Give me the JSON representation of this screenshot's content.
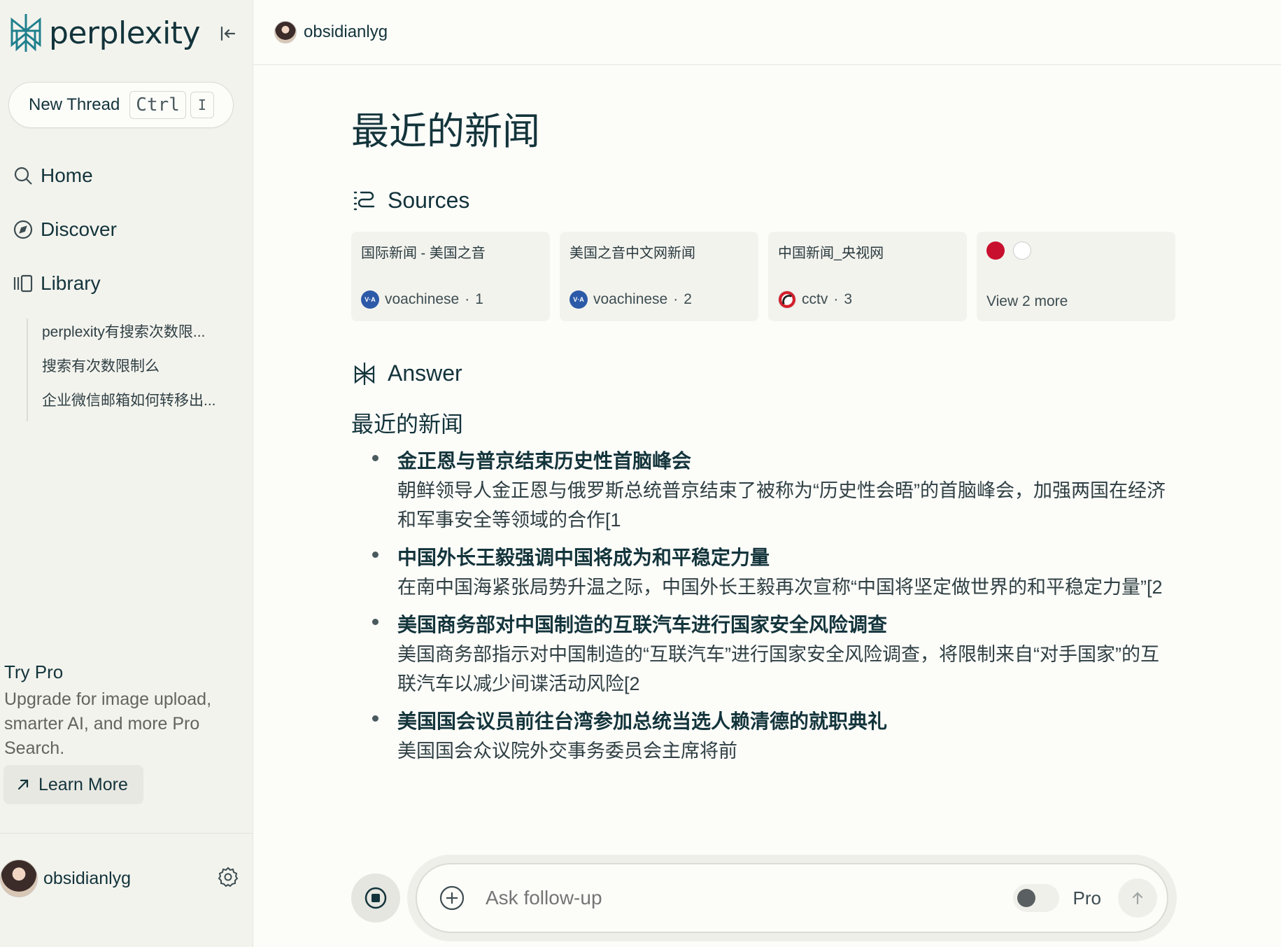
{
  "sidebar": {
    "brand": "perplexity",
    "new_thread": {
      "label": "New Thread",
      "kbd1": "Ctrl",
      "kbd2": "I"
    },
    "nav": [
      {
        "label": "Home",
        "icon": "search-icon"
      },
      {
        "label": "Discover",
        "icon": "compass-icon"
      },
      {
        "label": "Library",
        "icon": "library-icon"
      }
    ],
    "library_items": [
      "perplexity有搜索次数限...",
      "搜索有次数限制么",
      "企业微信邮箱如何转移出..."
    ],
    "try_pro": {
      "title": "Try Pro",
      "description": "Upgrade for image upload, smarter AI, and more Pro Search.",
      "learn_more": "Learn More"
    },
    "user": {
      "name": "obsidianlyg"
    }
  },
  "header": {
    "user_name": "obsidianlyg"
  },
  "main": {
    "title": "最近的新闻",
    "sources_heading": "Sources",
    "sources": [
      {
        "title": "国际新闻 - 美国之音",
        "site": "voachinese",
        "index": "1",
        "favicon": "V·A"
      },
      {
        "title": "美国之音中文网新闻",
        "site": "voachinese",
        "index": "2",
        "favicon": "V·A"
      },
      {
        "title": "中国新闻_央视网",
        "site": "cctv",
        "index": "3",
        "favicon": ""
      }
    ],
    "view_more": "View 2 more",
    "answer_heading": "Answer",
    "answer_subtitle": "最近的新闻",
    "answer_items": [
      {
        "title": "金正恩与普京结束历史性首脑峰会",
        "desc": "朝鲜领导人金正恩与俄罗斯总统普京结束了被称为“历史性会晤”的首脑峰会，加强两国在经济和军事安全等领域的合作[1"
      },
      {
        "title": "中国外长王毅强调中国将成为和平稳定力量",
        "desc": "在南中国海紧张局势升温之际，中国外长王毅再次宣称“中国将坚定做世界的和平稳定力量”[2"
      },
      {
        "title": "美国商务部对中国制造的互联汽车进行国家安全风险调查",
        "desc": "美国商务部指示对中国制造的“互联汽车”进行国家安全风险调查，将限制来自“对手国家”的互联汽车以减少间谍活动风险[2"
      },
      {
        "title": "美国国会议员前往台湾参加总统当选人赖清德的就职典礼",
        "desc": "美国国会众议院外交事务委员会主席将前"
      }
    ]
  },
  "followup": {
    "placeholder": "Ask follow-up",
    "pro_label": "Pro"
  },
  "colors": {
    "accent": "#20808d",
    "text": "#13343b",
    "sidebar_bg": "#f3f3ee",
    "page_bg": "#fcfcf9"
  }
}
